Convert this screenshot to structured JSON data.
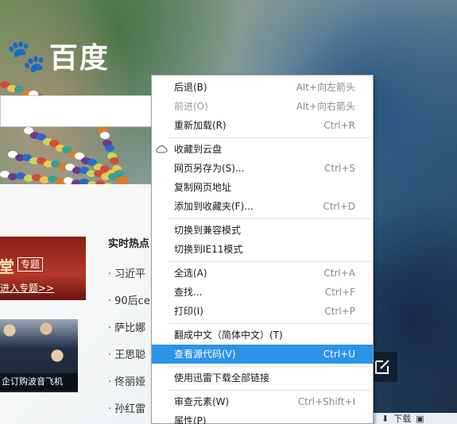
{
  "background": {
    "logo_text": "百度",
    "feature": {
      "title": "堂",
      "tag": "专题",
      "link": "进入专题>>"
    },
    "news_caption": "企订购波音飞机",
    "hot_news": {
      "title": "实时热点",
      "items": [
        "习近平",
        "90后ce",
        "萨比娜",
        "王思聪",
        "佟丽娅",
        "孙红雷"
      ]
    },
    "statusbar": {
      "download_label": "下载"
    }
  },
  "context_menu": {
    "groups": [
      [
        {
          "label": "后退(B)",
          "shortcut": "Alt+向左箭头",
          "disabled": false
        },
        {
          "label": "前进(O)",
          "shortcut": "Alt+向右箭头",
          "disabled": true
        },
        {
          "label": "重新加载(R)",
          "shortcut": "Ctrl+R",
          "disabled": false
        }
      ],
      [
        {
          "label": "收藏到云盘",
          "shortcut": "",
          "icon": "cloud-icon"
        },
        {
          "label": "网页另存为(S)...",
          "shortcut": "Ctrl+S"
        },
        {
          "label": "复制网页地址",
          "shortcut": ""
        },
        {
          "label": "添加到收藏夹(F)...",
          "shortcut": "Ctrl+D"
        }
      ],
      [
        {
          "label": "切换到兼容模式",
          "shortcut": ""
        },
        {
          "label": "切换到IE11模式",
          "shortcut": ""
        }
      ],
      [
        {
          "label": "全选(A)",
          "shortcut": "Ctrl+A"
        },
        {
          "label": "查找...",
          "shortcut": "Ctrl+F"
        },
        {
          "label": "打印(I)",
          "shortcut": "Ctrl+P"
        }
      ],
      [
        {
          "label": "翻成中文（简体中文）(T)",
          "shortcut": ""
        },
        {
          "label": "查看源代码(V)",
          "shortcut": "Ctrl+U",
          "highlighted": true
        }
      ],
      [
        {
          "label": "使用迅雷下载全部链接",
          "shortcut": ""
        }
      ],
      [
        {
          "label": "审查元素(W)",
          "shortcut": "Ctrl+Shift+I"
        },
        {
          "label": "属性(P)",
          "shortcut": ""
        }
      ]
    ]
  },
  "colors": {
    "highlight": "#2b93e8",
    "shortcut_text": "#8a8a8a",
    "disabled_text": "#9a9a9a"
  }
}
